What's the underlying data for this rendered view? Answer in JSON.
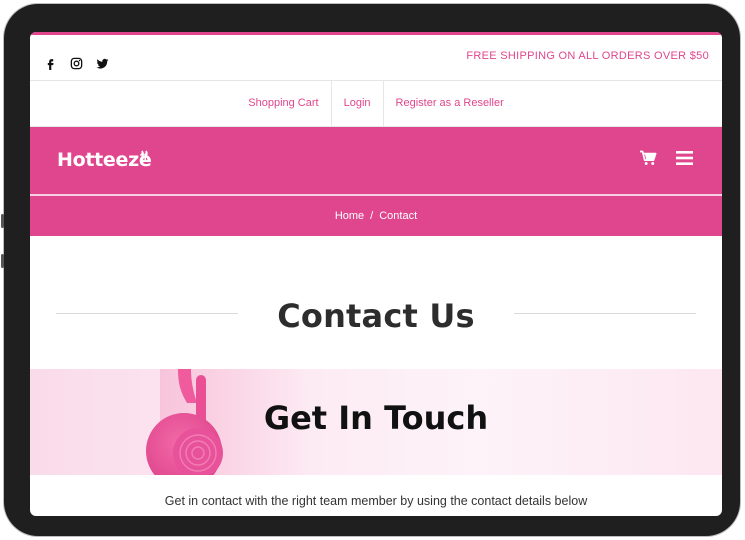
{
  "topbar": {
    "social_icons": [
      "facebook-icon",
      "instagram-icon",
      "twitter-icon"
    ],
    "promo_text": "FREE SHIPPING ON ALL ORDERS OVER $50"
  },
  "account_links": [
    "Shopping Cart",
    "Login",
    "Register as a Reseller"
  ],
  "header": {
    "logo_text": "Hotteeze",
    "icons": [
      "cart-icon",
      "menu-icon"
    ]
  },
  "breadcrumb": {
    "home": "Home",
    "separator": "/",
    "current": "Contact"
  },
  "page": {
    "title": "Contact Us",
    "banner_title": "Get In Touch",
    "intro_text": "Get in contact with the right team member by using the contact details below"
  },
  "colors": {
    "brand_pink": "#e0468d",
    "text_dark": "#2d2d2d",
    "device_frame": "#1f1f1f"
  }
}
